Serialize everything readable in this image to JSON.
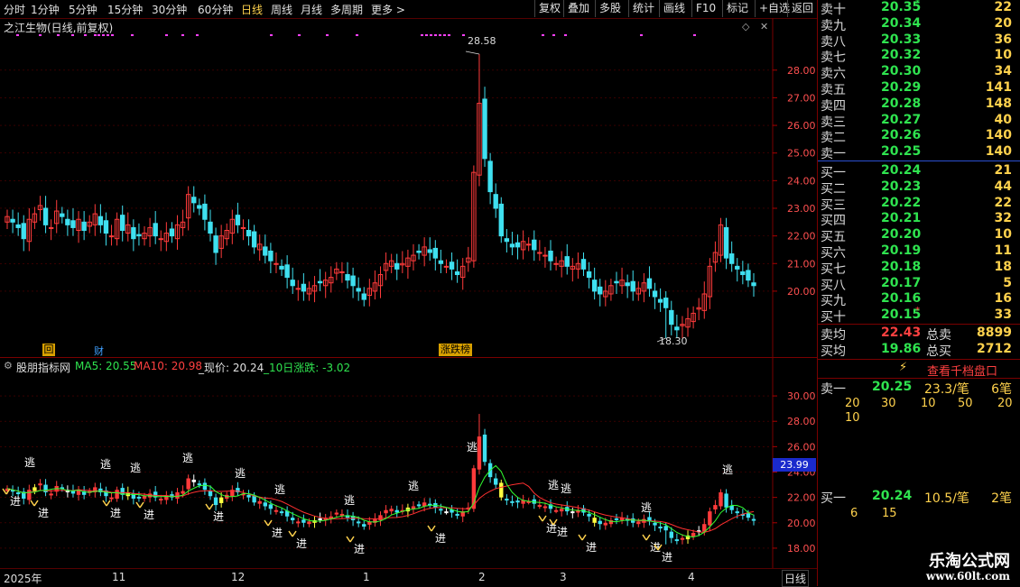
{
  "toolbar": {
    "periods": [
      "分时",
      "1分钟",
      "5分钟",
      "15分钟",
      "30分钟",
      "60分钟",
      "日线",
      "周线",
      "月线",
      "多周期",
      "更多"
    ],
    "active_period": "日线",
    "buttons": [
      "复权",
      "叠加",
      "多股",
      "统计",
      "画线",
      "F10",
      "标记",
      "+自选",
      "返回"
    ]
  },
  "main": {
    "title": "之江生物(日线,前复权)",
    "high_label": "28.58",
    "low_label": "18.30",
    "axis_ticks": [
      "28.00",
      "27.00",
      "26.00",
      "25.00",
      "24.00",
      "23.00",
      "22.00",
      "21.00",
      "20.00"
    ],
    "badges": {
      "hui": "回",
      "cai": "财",
      "zhangdie": "涨跌榜"
    }
  },
  "indicator": {
    "title": "股朋指标网",
    "ma5": "MA5: 20.55",
    "ma10": "MA10: 20.98",
    "now": "_现价: 20.24",
    "chg": "_10日涨跌: -3.02",
    "axis_ticks": [
      "30.00",
      "28.00",
      "26.00",
      "24.00",
      "22.00",
      "20.00",
      "18.00"
    ],
    "current_tag": "23.99",
    "escape_label": "逃",
    "enter_label": "进"
  },
  "bottom": {
    "months": [
      "2025年",
      "11",
      "12",
      "1",
      "2",
      "3",
      "4"
    ],
    "period_label": "日线"
  },
  "orderbook": {
    "asks": [
      {
        "label": "卖十",
        "price": "20.35",
        "vol": "22",
        "mark": "*"
      },
      {
        "label": "卖九",
        "price": "20.34",
        "vol": "20"
      },
      {
        "label": "卖八",
        "price": "20.33",
        "vol": "36"
      },
      {
        "label": "卖七",
        "price": "20.32",
        "vol": "10"
      },
      {
        "label": "卖六",
        "price": "20.30",
        "vol": "34"
      },
      {
        "label": "卖五",
        "price": "20.29",
        "vol": "141"
      },
      {
        "label": "卖四",
        "price": "20.28",
        "vol": "148"
      },
      {
        "label": "卖三",
        "price": "20.27",
        "vol": "40"
      },
      {
        "label": "卖二",
        "price": "20.26",
        "vol": "140"
      },
      {
        "label": "卖一",
        "price": "20.25",
        "vol": "140"
      }
    ],
    "bids": [
      {
        "label": "买一",
        "price": "20.24",
        "vol": "21"
      },
      {
        "label": "买二",
        "price": "20.23",
        "vol": "44"
      },
      {
        "label": "买三",
        "price": "20.22",
        "vol": "22"
      },
      {
        "label": "买四",
        "price": "20.21",
        "vol": "32"
      },
      {
        "label": "买五",
        "price": "20.20",
        "vol": "10"
      },
      {
        "label": "买六",
        "price": "20.19",
        "vol": "11"
      },
      {
        "label": "买七",
        "price": "20.18",
        "vol": "18"
      },
      {
        "label": "买八",
        "price": "20.17",
        "vol": "5"
      },
      {
        "label": "买九",
        "price": "20.16",
        "vol": "16"
      },
      {
        "label": "买十",
        "price": "20.15",
        "vol": "33",
        "mark": "*"
      }
    ],
    "avg_sell_label": "卖均",
    "avg_sell": "22.43",
    "total_sell_label": "总卖",
    "total_sell": "8899",
    "avg_buy_label": "买均",
    "avg_buy": "19.86",
    "total_buy_label": "总买",
    "total_buy": "2712",
    "view_thousand": "查看千档盘口",
    "sell1_label": "卖一",
    "sell1_price": "20.25",
    "sell1_avg": "23.3/笔",
    "sell1_count": "6笔",
    "sell1_orders": [
      "20",
      "30",
      "10",
      "50",
      "20",
      "10"
    ],
    "buy1_label": "买一",
    "buy1_price": "20.24",
    "buy1_avg": "10.5/笔",
    "buy1_count": "2笔",
    "buy1_orders": [
      "6",
      "15"
    ]
  },
  "watermark": {
    "title": "乐淘公式网",
    "url": "www.60lt.com"
  },
  "colors": {
    "up": "#ff3b3b",
    "down": "#3fe0f0",
    "ma5": "#ffffff",
    "ma10": "#ff3030",
    "ma20": "#30ff30",
    "grid": "#5a0000",
    "label_yellow": "#ffd24d",
    "label_green": "#2fe34f"
  }
}
